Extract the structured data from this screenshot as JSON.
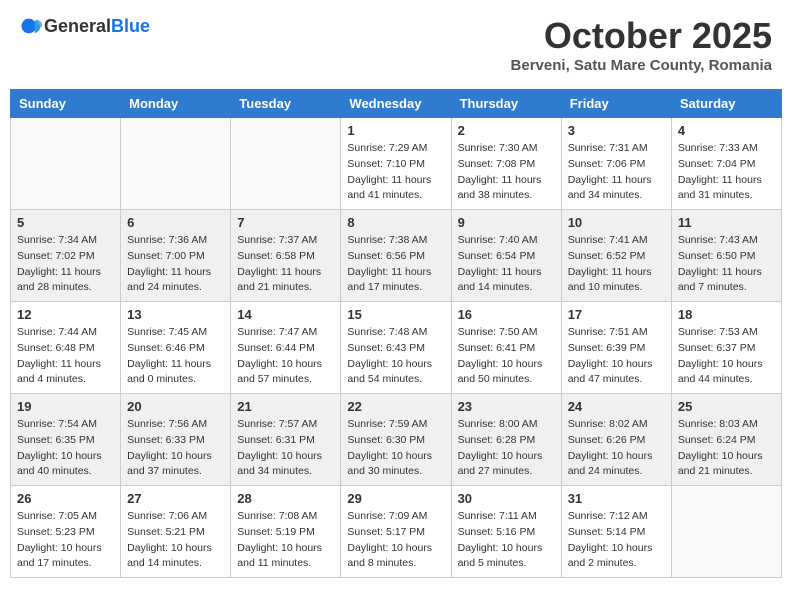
{
  "header": {
    "logo_general": "General",
    "logo_blue": "Blue",
    "month_title": "October 2025",
    "subtitle": "Berveni, Satu Mare County, Romania"
  },
  "days_of_week": [
    "Sunday",
    "Monday",
    "Tuesday",
    "Wednesday",
    "Thursday",
    "Friday",
    "Saturday"
  ],
  "weeks": [
    [
      {
        "day": "",
        "info": ""
      },
      {
        "day": "",
        "info": ""
      },
      {
        "day": "",
        "info": ""
      },
      {
        "day": "1",
        "info": "Sunrise: 7:29 AM\nSunset: 7:10 PM\nDaylight: 11 hours and 41 minutes."
      },
      {
        "day": "2",
        "info": "Sunrise: 7:30 AM\nSunset: 7:08 PM\nDaylight: 11 hours and 38 minutes."
      },
      {
        "day": "3",
        "info": "Sunrise: 7:31 AM\nSunset: 7:06 PM\nDaylight: 11 hours and 34 minutes."
      },
      {
        "day": "4",
        "info": "Sunrise: 7:33 AM\nSunset: 7:04 PM\nDaylight: 11 hours and 31 minutes."
      }
    ],
    [
      {
        "day": "5",
        "info": "Sunrise: 7:34 AM\nSunset: 7:02 PM\nDaylight: 11 hours and 28 minutes."
      },
      {
        "day": "6",
        "info": "Sunrise: 7:36 AM\nSunset: 7:00 PM\nDaylight: 11 hours and 24 minutes."
      },
      {
        "day": "7",
        "info": "Sunrise: 7:37 AM\nSunset: 6:58 PM\nDaylight: 11 hours and 21 minutes."
      },
      {
        "day": "8",
        "info": "Sunrise: 7:38 AM\nSunset: 6:56 PM\nDaylight: 11 hours and 17 minutes."
      },
      {
        "day": "9",
        "info": "Sunrise: 7:40 AM\nSunset: 6:54 PM\nDaylight: 11 hours and 14 minutes."
      },
      {
        "day": "10",
        "info": "Sunrise: 7:41 AM\nSunset: 6:52 PM\nDaylight: 11 hours and 10 minutes."
      },
      {
        "day": "11",
        "info": "Sunrise: 7:43 AM\nSunset: 6:50 PM\nDaylight: 11 hours and 7 minutes."
      }
    ],
    [
      {
        "day": "12",
        "info": "Sunrise: 7:44 AM\nSunset: 6:48 PM\nDaylight: 11 hours and 4 minutes."
      },
      {
        "day": "13",
        "info": "Sunrise: 7:45 AM\nSunset: 6:46 PM\nDaylight: 11 hours and 0 minutes."
      },
      {
        "day": "14",
        "info": "Sunrise: 7:47 AM\nSunset: 6:44 PM\nDaylight: 10 hours and 57 minutes."
      },
      {
        "day": "15",
        "info": "Sunrise: 7:48 AM\nSunset: 6:43 PM\nDaylight: 10 hours and 54 minutes."
      },
      {
        "day": "16",
        "info": "Sunrise: 7:50 AM\nSunset: 6:41 PM\nDaylight: 10 hours and 50 minutes."
      },
      {
        "day": "17",
        "info": "Sunrise: 7:51 AM\nSunset: 6:39 PM\nDaylight: 10 hours and 47 minutes."
      },
      {
        "day": "18",
        "info": "Sunrise: 7:53 AM\nSunset: 6:37 PM\nDaylight: 10 hours and 44 minutes."
      }
    ],
    [
      {
        "day": "19",
        "info": "Sunrise: 7:54 AM\nSunset: 6:35 PM\nDaylight: 10 hours and 40 minutes."
      },
      {
        "day": "20",
        "info": "Sunrise: 7:56 AM\nSunset: 6:33 PM\nDaylight: 10 hours and 37 minutes."
      },
      {
        "day": "21",
        "info": "Sunrise: 7:57 AM\nSunset: 6:31 PM\nDaylight: 10 hours and 34 minutes."
      },
      {
        "day": "22",
        "info": "Sunrise: 7:59 AM\nSunset: 6:30 PM\nDaylight: 10 hours and 30 minutes."
      },
      {
        "day": "23",
        "info": "Sunrise: 8:00 AM\nSunset: 6:28 PM\nDaylight: 10 hours and 27 minutes."
      },
      {
        "day": "24",
        "info": "Sunrise: 8:02 AM\nSunset: 6:26 PM\nDaylight: 10 hours and 24 minutes."
      },
      {
        "day": "25",
        "info": "Sunrise: 8:03 AM\nSunset: 6:24 PM\nDaylight: 10 hours and 21 minutes."
      }
    ],
    [
      {
        "day": "26",
        "info": "Sunrise: 7:05 AM\nSunset: 5:23 PM\nDaylight: 10 hours and 17 minutes."
      },
      {
        "day": "27",
        "info": "Sunrise: 7:06 AM\nSunset: 5:21 PM\nDaylight: 10 hours and 14 minutes."
      },
      {
        "day": "28",
        "info": "Sunrise: 7:08 AM\nSunset: 5:19 PM\nDaylight: 10 hours and 11 minutes."
      },
      {
        "day": "29",
        "info": "Sunrise: 7:09 AM\nSunset: 5:17 PM\nDaylight: 10 hours and 8 minutes."
      },
      {
        "day": "30",
        "info": "Sunrise: 7:11 AM\nSunset: 5:16 PM\nDaylight: 10 hours and 5 minutes."
      },
      {
        "day": "31",
        "info": "Sunrise: 7:12 AM\nSunset: 5:14 PM\nDaylight: 10 hours and 2 minutes."
      },
      {
        "day": "",
        "info": ""
      }
    ]
  ]
}
